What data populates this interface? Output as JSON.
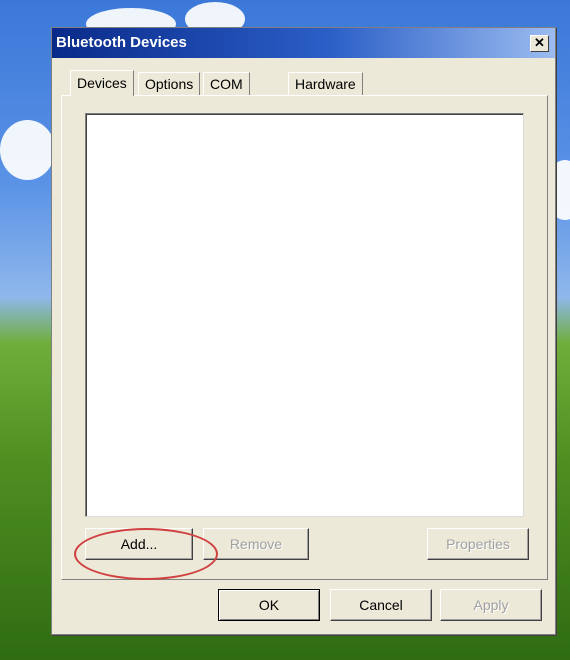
{
  "window": {
    "title": "Bluetooth Devices",
    "close_glyph": "✕"
  },
  "tabs": [
    {
      "label": "Devices",
      "active": true
    },
    {
      "label": "Options",
      "active": false
    },
    {
      "label": "COM Ports",
      "active": false
    },
    {
      "label": "Hardware",
      "active": false
    }
  ],
  "device_list": {
    "items": []
  },
  "panel_buttons": {
    "add": "Add...",
    "remove": "Remove",
    "properties": "Properties"
  },
  "dialog_buttons": {
    "ok": "OK",
    "cancel": "Cancel",
    "apply": "Apply"
  },
  "colors": {
    "titlebar_start": "#0a2a8a",
    "titlebar_end": "#9cbcf0",
    "dialog_face": "#ece9d8",
    "annotation": "#d04040"
  }
}
